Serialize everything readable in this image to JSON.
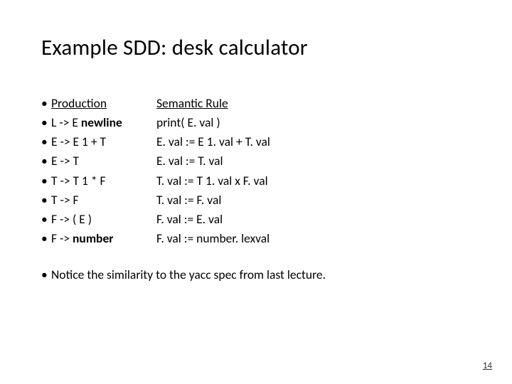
{
  "title": "Example SDD: desk calculator",
  "header": {
    "production": "Production",
    "rule": "Semantic Rule"
  },
  "rows": [
    {
      "p_pre": "L -> E ",
      "p_bold": "newline",
      "rule": "print( E. val )"
    },
    {
      "p_pre": "E -> E 1 + T",
      "p_bold": "",
      "rule": "E. val := E 1. val + T. val"
    },
    {
      "p_pre": "E -> T",
      "p_bold": "",
      "rule": "E. val := T. val"
    },
    {
      "p_pre": "T -> T 1 * F",
      "p_bold": "",
      "rule": "T. val := T 1. val x F. val"
    },
    {
      "p_pre": "T -> F",
      "p_bold": "",
      "rule": "T. val := F. val"
    },
    {
      "p_pre": "F -> ( E )",
      "p_bold": "",
      "rule": "F. val := E. val"
    },
    {
      "p_pre": "F -> ",
      "p_bold": "number",
      "rule": "F. val := number. lexval"
    }
  ],
  "note": "Notice the similarity to the yacc spec from last lecture.",
  "page_number": "14",
  "bullet_char": "•"
}
